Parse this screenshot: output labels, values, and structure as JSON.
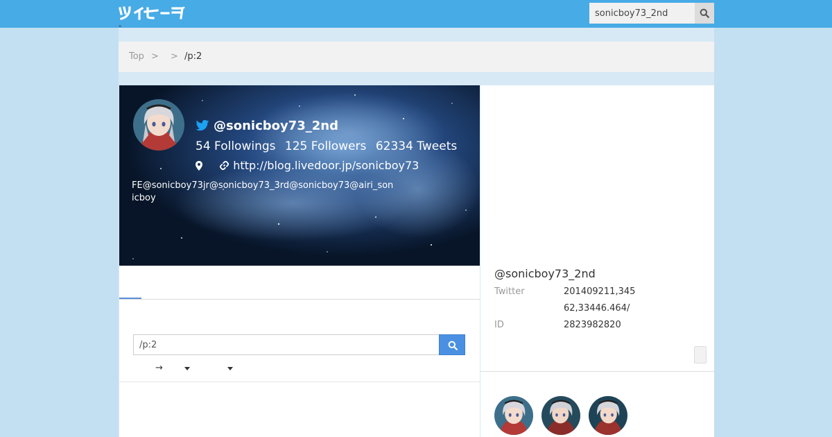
{
  "search": {
    "value": "sonicboy73_2nd"
  },
  "tiny_mark": "\"",
  "breadcrumb": {
    "top": "Top",
    "sep1": ">",
    "sep2": ">",
    "current": "/p:2"
  },
  "profile": {
    "handle": "@sonicboy73_2nd",
    "followings": "54 Followings",
    "followers": "125 Followers",
    "tweets": "62334 Tweets",
    "link": "http://blog.livedoor.jp/sonicboy73",
    "bio": " FE@sonicboy73jr@sonicboy73_3rd@sonicboy73@airi_sonicboy"
  },
  "query": {
    "value": "/p:2"
  },
  "controls": {
    "arrow": "→"
  },
  "info": {
    "name": "@sonicboy73_2nd",
    "twitter_label": "Twitter",
    "twitter_value_1": "201409211,345",
    "twitter_value_2": "62,33446.464/",
    "id_label": "ID",
    "id_value": "2823982820"
  },
  "colors": {
    "topbar": "#47abe6",
    "accent": "#4a90e2",
    "twitter": "#1da1f2"
  },
  "icons": [
    "logo-icon",
    "search-icon",
    "twitter-icon",
    "map-marker-icon",
    "link-icon",
    "avatar"
  ]
}
